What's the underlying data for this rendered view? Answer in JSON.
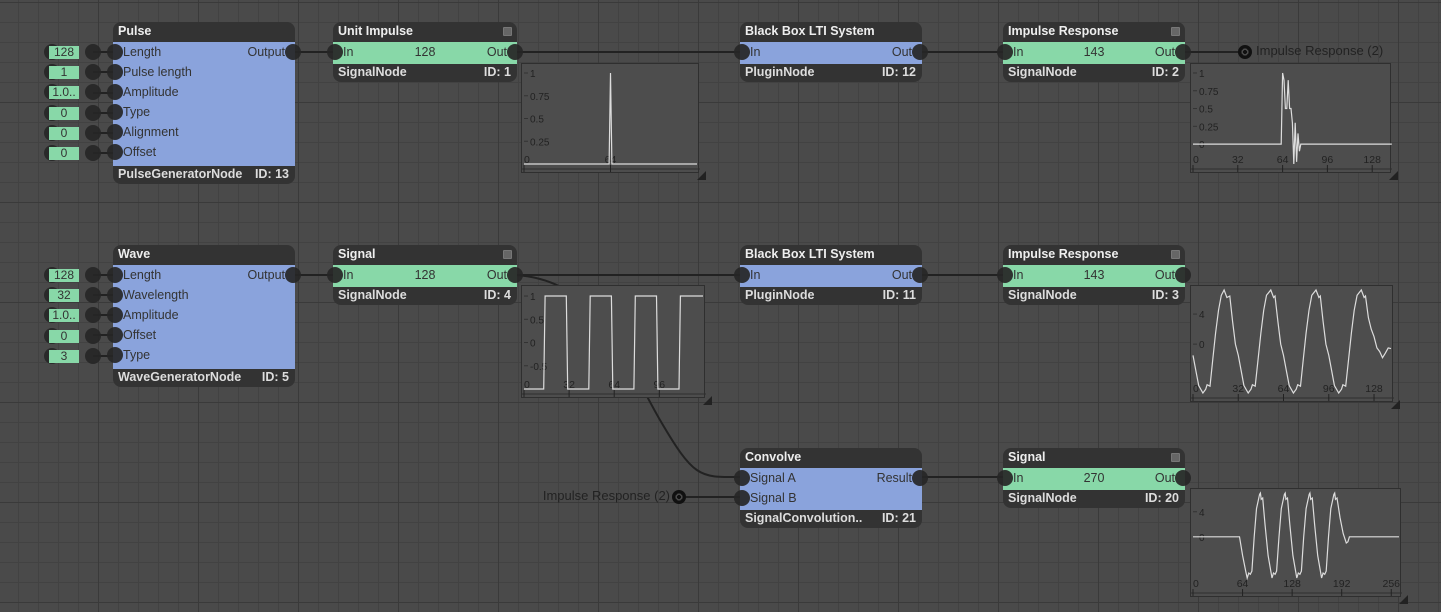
{
  "colors": {
    "canvas": "#4a4a4a",
    "generator_node": "#8aa3dc",
    "signal_node": "#88d8a8",
    "plugin_node": "#8aa3dc",
    "header": "#333333",
    "wire": "#222222",
    "plot_line": "#dddddd"
  },
  "nodes": [
    {
      "title": "Pulse",
      "type": "PulseGeneratorNode",
      "id": "ID: 13",
      "kind": "generator",
      "inputs": [
        "Length",
        "Pulse length",
        "Amplitude",
        "Type",
        "Alignment",
        "Offset"
      ],
      "output": "Output",
      "widgets": [
        "128",
        "1",
        "1.0..",
        "0",
        "0",
        "0"
      ]
    },
    {
      "title": "Unit Impulse",
      "type": "SignalNode",
      "id": "ID: 1",
      "kind": "signal",
      "input": "In",
      "value": "128",
      "output": "Out",
      "minimize_icon": "minimize-icon"
    },
    {
      "title": "Black Box LTI System",
      "type": "PluginNode",
      "id": "ID: 12",
      "kind": "plugin",
      "inputs": [
        "In"
      ],
      "output": "Out"
    },
    {
      "title": "Impulse Response",
      "type": "SignalNode",
      "id": "ID: 2",
      "kind": "signal",
      "input": "In",
      "value": "143",
      "output": "Out",
      "minimize_icon": "minimize-icon"
    },
    {
      "title": "Wave",
      "type": "WaveGeneratorNode",
      "id": "ID: 5",
      "kind": "generator",
      "inputs": [
        "Length",
        "Wavelength",
        "Amplitude",
        "Offset",
        "Type"
      ],
      "output": "Output",
      "widgets": [
        "128",
        "32",
        "1.0..",
        "0",
        "3"
      ]
    },
    {
      "title": "Signal",
      "type": "SignalNode",
      "id": "ID: 4",
      "kind": "signal",
      "input": "In",
      "value": "128",
      "output": "Out",
      "minimize_icon": "minimize-icon"
    },
    {
      "title": "Black Box LTI System",
      "type": "PluginNode",
      "id": "ID: 11",
      "kind": "plugin",
      "inputs": [
        "In"
      ],
      "output": "Out"
    },
    {
      "title": "Impulse Response",
      "type": "SignalNode",
      "id": "ID: 3",
      "kind": "signal",
      "input": "In",
      "value": "143",
      "output": "Out",
      "minimize_icon": "minimize-icon"
    },
    {
      "title": "Convolve",
      "type": "SignalConvolution..",
      "id": "ID: 21",
      "kind": "plugin",
      "inputs": [
        "Signal A",
        "Signal B"
      ],
      "output": "Result"
    },
    {
      "title": "Signal",
      "type": "SignalNode",
      "id": "ID: 20",
      "kind": "signal",
      "input": "In",
      "value": "270",
      "output": "Out",
      "minimize_icon": "minimize-icon"
    }
  ],
  "references": {
    "out_label": "Impulse Response (2)",
    "in_label": "Impulse Response (2)",
    "icon": "target-icon"
  },
  "chart_data": [
    {
      "type": "line",
      "owner": "Unit Impulse",
      "xlim": [
        0,
        128
      ],
      "ylim": [
        0,
        1.055
      ],
      "xticks": [
        0,
        64
      ],
      "yticks": [
        0.25,
        0.5,
        0.75,
        1
      ],
      "points": [
        [
          0,
          0
        ],
        [
          63,
          0
        ],
        [
          64,
          1
        ],
        [
          65,
          0
        ],
        [
          128,
          0
        ]
      ]
    },
    {
      "type": "line",
      "owner": "Impulse Response (ID: 2)",
      "xlim": [
        0,
        140
      ],
      "ylim": [
        -0.28,
        1.07
      ],
      "xticks": [
        0,
        32,
        64,
        96,
        128
      ],
      "yticks": [
        0,
        0.25,
        0.5,
        0.75,
        1
      ],
      "points": [
        [
          0,
          0
        ],
        [
          63,
          0
        ],
        [
          64,
          1
        ],
        [
          65,
          0.9
        ],
        [
          66,
          0.5
        ],
        [
          67,
          0.5
        ],
        [
          68,
          0.9
        ],
        [
          69,
          0.5
        ],
        [
          70,
          0.5
        ],
        [
          71,
          0.3
        ],
        [
          72,
          -0.28
        ],
        [
          73,
          0.3
        ],
        [
          74,
          -0.25
        ],
        [
          75,
          0.15
        ],
        [
          76,
          -0.1
        ],
        [
          77,
          0
        ],
        [
          142,
          0
        ]
      ]
    },
    {
      "type": "line",
      "owner": "Signal (ID: 4)",
      "xlim": [
        0,
        127
      ],
      "ylim": [
        -1,
        1.13
      ],
      "xticks": [
        0,
        32,
        64,
        96
      ],
      "yticks": [
        -0.5,
        0,
        0.5,
        1
      ],
      "points": [
        [
          0,
          -1
        ],
        [
          14,
          -1
        ],
        [
          15,
          1
        ],
        [
          30,
          1
        ],
        [
          31,
          -1
        ],
        [
          46,
          -1
        ],
        [
          47,
          1
        ],
        [
          62,
          1
        ],
        [
          63,
          -1
        ],
        [
          78,
          -1
        ],
        [
          79,
          1
        ],
        [
          94,
          1
        ],
        [
          95,
          -1
        ],
        [
          110,
          -1
        ],
        [
          111,
          1
        ],
        [
          127,
          1
        ]
      ]
    },
    {
      "type": "line",
      "owner": "Impulse Response (ID: 3)",
      "xlim": [
        0,
        140
      ],
      "ylim": [
        -6.5,
        7.2
      ],
      "xticks": [
        0,
        32,
        64,
        96,
        128
      ],
      "yticks": [
        0,
        4
      ],
      "points": [
        [
          0,
          -1.5
        ],
        [
          2,
          -3.5
        ],
        [
          4,
          -5.5
        ],
        [
          7,
          -6.5
        ],
        [
          9,
          -6
        ],
        [
          10,
          -5.4
        ],
        [
          12,
          -5.6
        ],
        [
          14,
          -2
        ],
        [
          16,
          1.5
        ],
        [
          18,
          4.5
        ],
        [
          20,
          6.5
        ],
        [
          22,
          7.2
        ],
        [
          24,
          6.2
        ],
        [
          26,
          6.4
        ],
        [
          28,
          3
        ],
        [
          30,
          0
        ],
        [
          32,
          -1.5
        ],
        [
          34,
          -3.5
        ],
        [
          36,
          -5.5
        ],
        [
          39,
          -6.5
        ],
        [
          41,
          -6
        ],
        [
          42,
          -5.4
        ],
        [
          44,
          -5.6
        ],
        [
          46,
          -2
        ],
        [
          48,
          1.5
        ],
        [
          50,
          4.5
        ],
        [
          52,
          6.5
        ],
        [
          55,
          7.2
        ],
        [
          57,
          6.2
        ],
        [
          58,
          6.4
        ],
        [
          60,
          3
        ],
        [
          62,
          0
        ],
        [
          64,
          -1.5
        ],
        [
          66,
          -3.5
        ],
        [
          68,
          -5.5
        ],
        [
          71,
          -6.5
        ],
        [
          73,
          -6
        ],
        [
          74,
          -5.4
        ],
        [
          76,
          -5.6
        ],
        [
          78,
          -2
        ],
        [
          80,
          1.5
        ],
        [
          82,
          4.5
        ],
        [
          84,
          6.5
        ],
        [
          87,
          7.2
        ],
        [
          89,
          6.2
        ],
        [
          90,
          6.4
        ],
        [
          92,
          3
        ],
        [
          94,
          0
        ],
        [
          96,
          -1.5
        ],
        [
          98,
          -3.5
        ],
        [
          100,
          -5.5
        ],
        [
          103,
          -6.5
        ],
        [
          105,
          -6
        ],
        [
          106,
          -5.4
        ],
        [
          108,
          -5.6
        ],
        [
          110,
          -2
        ],
        [
          112,
          1.5
        ],
        [
          114,
          4.5
        ],
        [
          116,
          6.5
        ],
        [
          119,
          7.2
        ],
        [
          121,
          6.2
        ],
        [
          122,
          6.4
        ],
        [
          124,
          3.5
        ],
        [
          126,
          2
        ],
        [
          128,
          1
        ],
        [
          130,
          -0.5
        ],
        [
          132,
          -1
        ],
        [
          134,
          -1.8
        ],
        [
          136,
          -1.2
        ],
        [
          138,
          -0.5
        ],
        [
          140,
          -0.6
        ]
      ]
    },
    {
      "type": "line",
      "owner": "Signal (ID: 20)",
      "xlim": [
        0,
        266
      ],
      "ylim": [
        -8.2,
        7
      ],
      "xticks": [
        0,
        64,
        128,
        192,
        256
      ],
      "yticks": [
        0,
        4
      ],
      "points": [
        [
          0,
          0
        ],
        [
          60,
          0
        ],
        [
          64,
          -3
        ],
        [
          68,
          -5.5
        ],
        [
          70,
          -6.6
        ],
        [
          72,
          -5.8
        ],
        [
          74,
          -6
        ],
        [
          76,
          -5.5
        ],
        [
          79,
          0
        ],
        [
          82,
          4.5
        ],
        [
          86,
          6.8
        ],
        [
          87,
          7
        ],
        [
          88,
          6
        ],
        [
          90,
          6.2
        ],
        [
          93,
          2
        ],
        [
          97,
          -3
        ],
        [
          102,
          -6.6
        ],
        [
          104,
          -5.8
        ],
        [
          106,
          -6
        ],
        [
          108,
          -5.5
        ],
        [
          111,
          0
        ],
        [
          114,
          4.5
        ],
        [
          118,
          6.8
        ],
        [
          119,
          7
        ],
        [
          120,
          6
        ],
        [
          122,
          6.2
        ],
        [
          125,
          2
        ],
        [
          129,
          -3
        ],
        [
          134,
          -6.6
        ],
        [
          136,
          -5.8
        ],
        [
          138,
          -6
        ],
        [
          140,
          -5.5
        ],
        [
          143,
          0
        ],
        [
          146,
          4.5
        ],
        [
          150,
          6.8
        ],
        [
          151,
          7
        ],
        [
          152,
          6
        ],
        [
          154,
          6.2
        ],
        [
          157,
          2
        ],
        [
          161,
          -3
        ],
        [
          166,
          -6.6
        ],
        [
          168,
          -5.8
        ],
        [
          170,
          -6
        ],
        [
          172,
          -5.5
        ],
        [
          175,
          0
        ],
        [
          178,
          4.5
        ],
        [
          182,
          6.8
        ],
        [
          183,
          7
        ],
        [
          184,
          6
        ],
        [
          186,
          6.2
        ],
        [
          190,
          3
        ],
        [
          194,
          0.5
        ],
        [
          198,
          -1
        ],
        [
          200,
          -0.8
        ],
        [
          202,
          0
        ],
        [
          266,
          0
        ]
      ]
    }
  ]
}
